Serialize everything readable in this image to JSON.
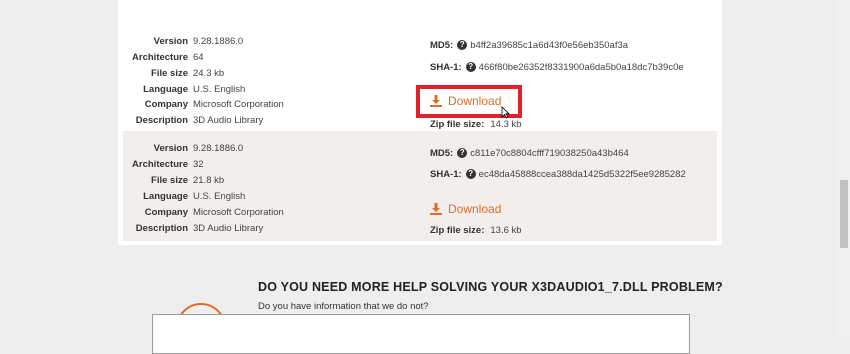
{
  "labels": {
    "version": "Version",
    "architecture": "Architecture",
    "file_size": "File size",
    "language": "Language",
    "company": "Company",
    "description": "Description",
    "md5": "MD5:",
    "sha1": "SHA-1:",
    "download": "Download",
    "zip_file_size": "Zip file size:"
  },
  "files": [
    {
      "version": "9.28.1886.0",
      "architecture": "64",
      "file_size": "24.3 kb",
      "language": "U.S. English",
      "company": "Microsoft Corporation",
      "description": "3D Audio Library",
      "md5": "b4ff2a39685c1a6d43f0e56eb350af3a",
      "sha1": "466f80be26352f8331900a6da5b0a18dc7b39c0e",
      "zip_file_size": "14.3 kb"
    },
    {
      "version": "9.28.1886.0",
      "architecture": "32",
      "file_size": "21.8 kb",
      "language": "U.S. English",
      "company": "Microsoft Corporation",
      "description": "3D Audio Library",
      "md5": "c811e70c8804cfff719038250a43b464",
      "sha1": "ec48da45888ccea388da1425d5322f5ee9285282",
      "zip_file_size": "13.6 kb"
    }
  ],
  "help": {
    "title": "DO YOU NEED MORE HELP SOLVING YOUR X3DAUDIO1_7.DLL PROBLEM?",
    "subtitle": "Do you have information that we do not?"
  },
  "colors": {
    "accent": "#e06c2a",
    "highlight": "#e0232a"
  },
  "icons": {
    "download": "download-icon",
    "help": "question-circle-icon"
  }
}
